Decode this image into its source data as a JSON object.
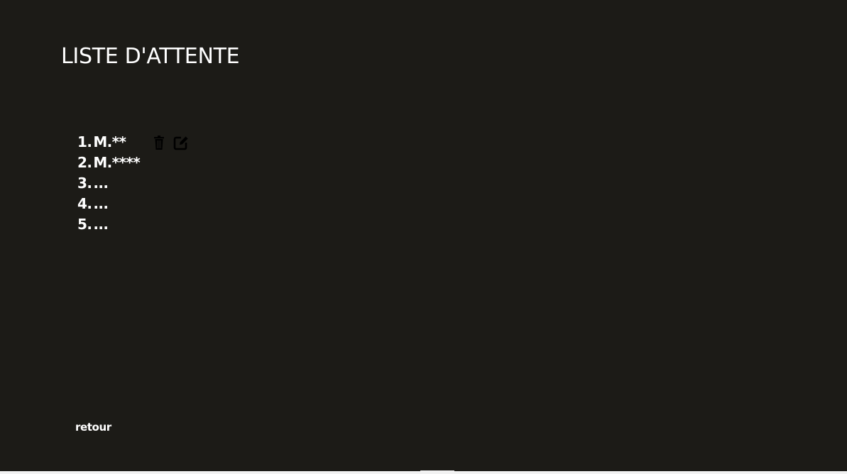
{
  "page": {
    "title": "LISTE D'ATTENTE",
    "back_label": "retour"
  },
  "waitlist": {
    "items": [
      {
        "number": "1.",
        "name": "M.**",
        "icons": [
          "trash-icon",
          "edit-icon"
        ]
      },
      {
        "number": "2.",
        "name": "M.****"
      },
      {
        "number": "3.",
        "name": "..."
      },
      {
        "number": "4.",
        "name": "..."
      },
      {
        "number": "5.",
        "name": "..."
      }
    ]
  },
  "colors": {
    "background": "#1c1b17",
    "text": "#ffffff",
    "icon": "#000000"
  }
}
